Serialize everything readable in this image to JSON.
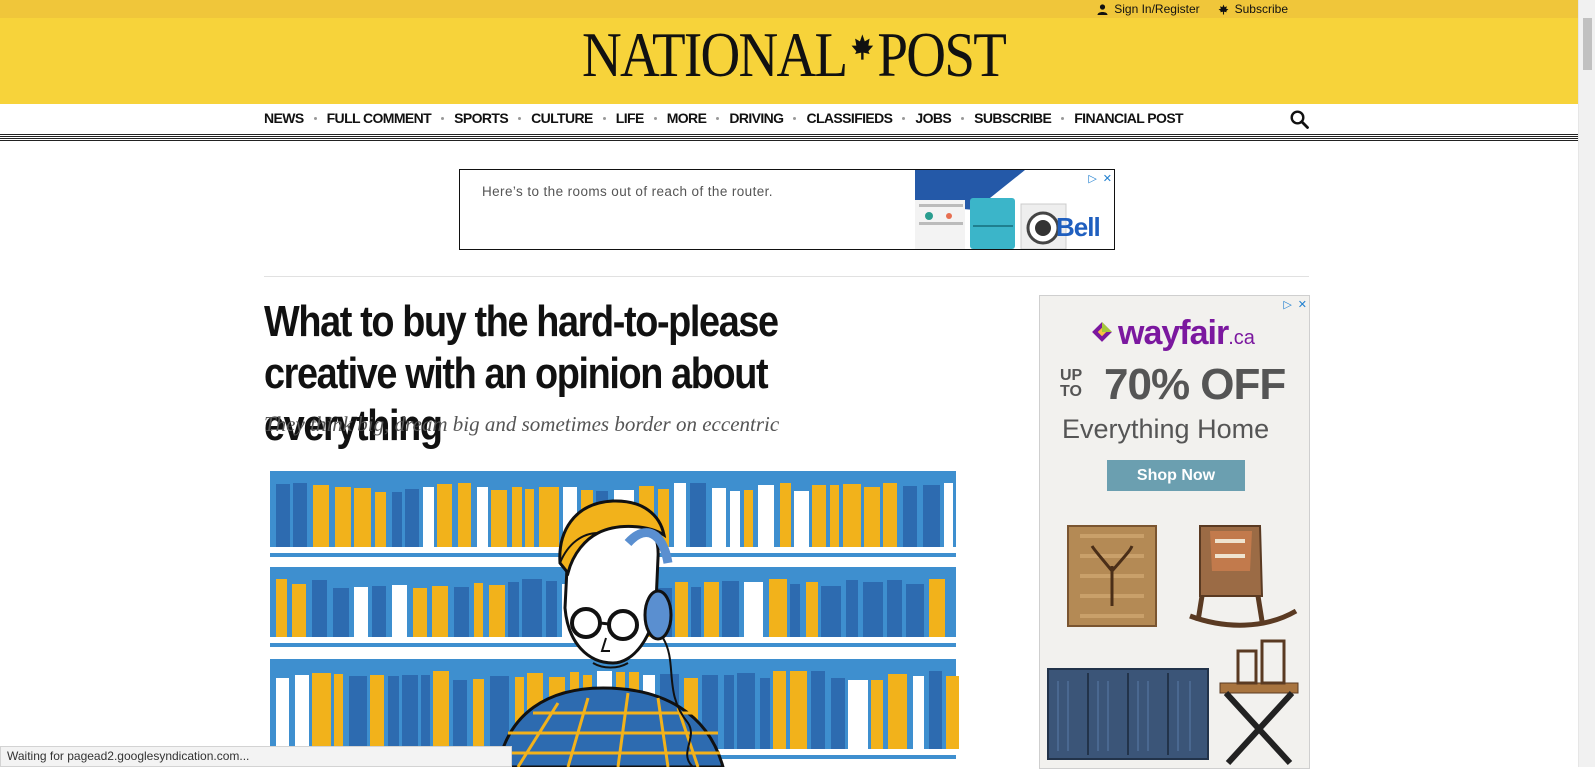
{
  "topbar": {
    "sign_in": "Sign In/Register",
    "subscribe": "Subscribe",
    "colors": {
      "top_strip": "#f0c63a",
      "brand_bar": "#f7d33a"
    }
  },
  "brand": {
    "left": "NATIONAL",
    "right": "POST",
    "icon": "maple-leaf-icon"
  },
  "nav": {
    "items": [
      "NEWS",
      "FULL COMMENT",
      "SPORTS",
      "CULTURE",
      "LIFE",
      "MORE",
      "DRIVING",
      "CLASSIFIEDS",
      "JOBS",
      "SUBSCRIBE",
      "FINANCIAL POST"
    ],
    "search_icon": "search-icon"
  },
  "ad_top": {
    "text": "Here’s to the rooms out of reach of the router.",
    "brand": "Bell",
    "accent": "#1f5fbf"
  },
  "article": {
    "headline": "What to buy the hard-to-please creative with an opinion about everything",
    "dek": "They think big, dream big and sometimes border on eccentric"
  },
  "ad_side": {
    "brand": "wayfair",
    "brand_suffix": ".ca",
    "upto_1": "UP",
    "upto_2": "TO",
    "percent": "70% OFF",
    "tagline": "Everything Home",
    "cta": "Shop Now",
    "brand_color": "#7b189f",
    "cta_color": "#6b9fb0"
  },
  "status_bar": {
    "text": "Waiting for pagead2.googlesyndication.com..."
  }
}
